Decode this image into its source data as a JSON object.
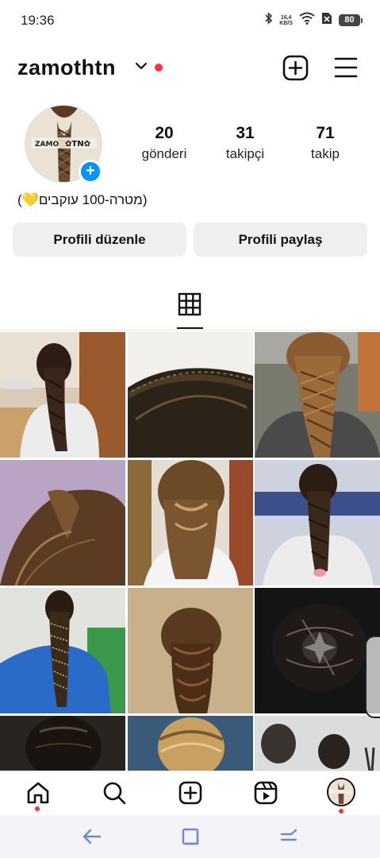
{
  "status_bar": {
    "time": "19:36",
    "net_speed_value": "16,4",
    "net_speed_unit": "KB/S",
    "battery": "80"
  },
  "header": {
    "username": "zamothtn"
  },
  "profile": {
    "stats": [
      {
        "value": "20",
        "label": "gönderi"
      },
      {
        "value": "31",
        "label": "takipçi"
      },
      {
        "value": "71",
        "label": "takip"
      }
    ],
    "bio": "(💛מטרה-100 עוקבים)",
    "edit_button": "Profili düzenle",
    "share_button": "Profili paylaş"
  },
  "colors": {
    "accent_blue": "#0095f6",
    "notification_red": "#ff3040",
    "button_bg": "#efefef"
  },
  "icons": {
    "header": [
      "chevron-down-icon",
      "create-post-icon",
      "menu-icon"
    ],
    "tabs": [
      "grid-icon"
    ],
    "bottom_nav": [
      "home-icon",
      "search-icon",
      "create-icon",
      "reels-icon",
      "profile-avatar"
    ],
    "system_nav": [
      "back-icon",
      "recents-icon",
      "menu-gesture-icon"
    ]
  },
  "grid": {
    "posts": [
      "braid-photo-1",
      "braid-photo-2",
      "braid-photo-3",
      "braid-photo-4",
      "braid-photo-5",
      "braid-photo-6",
      "braid-photo-7",
      "braid-photo-8",
      "braid-photo-9",
      "braid-photo-10",
      "braid-photo-11",
      "braid-photo-12"
    ]
  }
}
